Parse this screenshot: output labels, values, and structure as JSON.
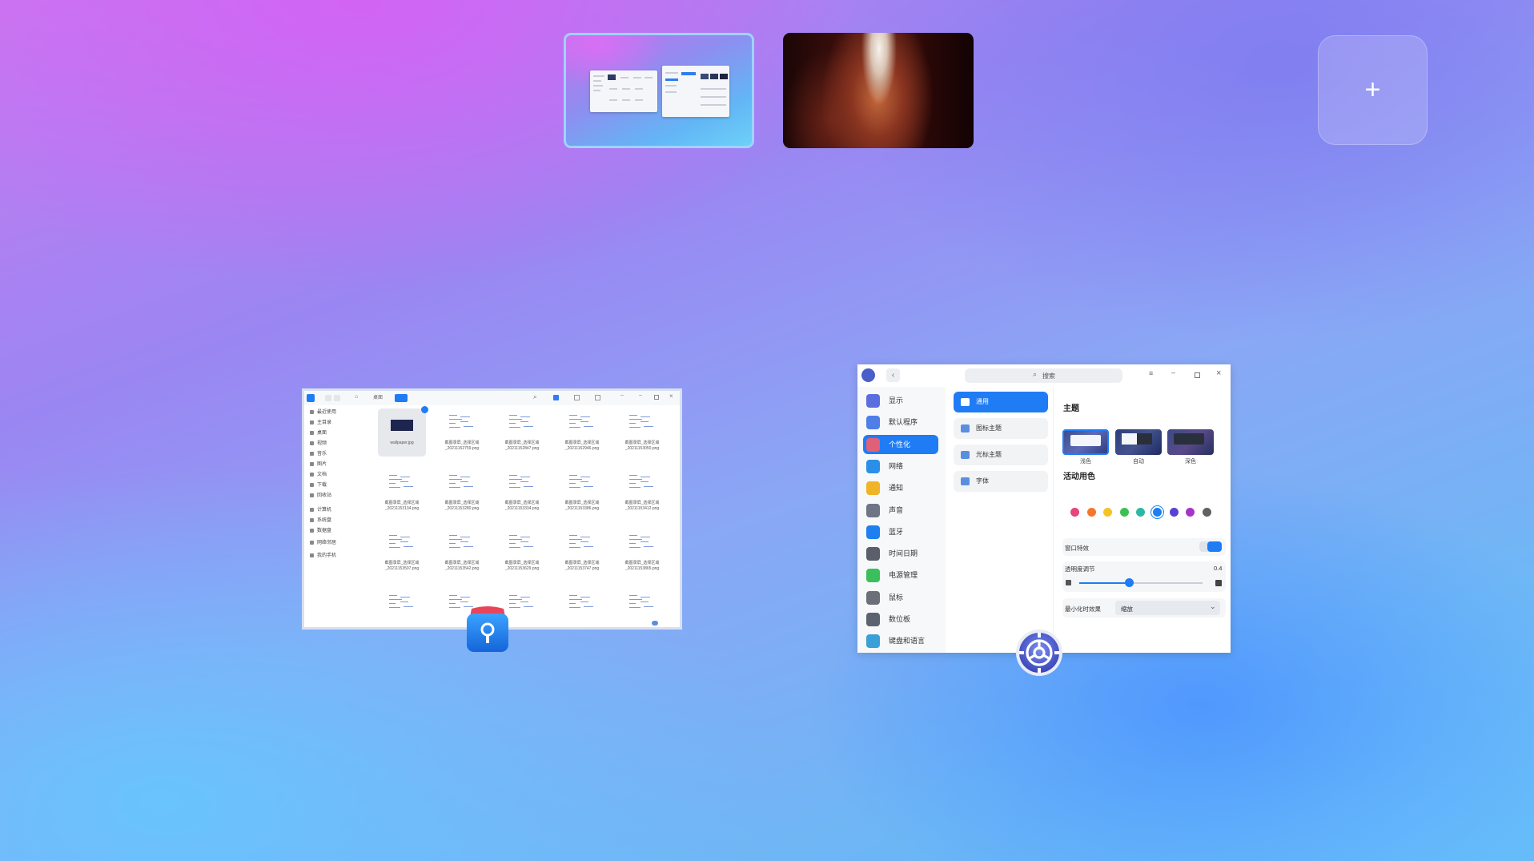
{
  "workspaces": {
    "add_label": "+"
  },
  "file_manager": {
    "path_label": "桌面",
    "sidebar": [
      "最近使用",
      "主目录",
      "桌面",
      "视频",
      "音乐",
      "图片",
      "文档",
      "下载",
      "回收站",
      "计算机",
      "系统盘",
      "数据盘",
      "网络邻居",
      "我的手机"
    ],
    "files": [
      "wallpaper.jpg",
      "截图录屏_选择区域_20211152759.png",
      "截图录屏_选择区域_20211152847.png",
      "截图录屏_选择区域_20211152946.png",
      "截图录屏_选择区域_20211153050.png",
      "截图录屏_选择区域_20211153134.png",
      "截图录屏_选择区域_20211153280.png",
      "截图录屏_选择区域_20211153334.png",
      "截图录屏_选择区域_20211153386.png",
      "截图录屏_选择区域_20211153412.png",
      "截图录屏_选择区域_20211153507.png",
      "截图录屏_选择区域_20211153542.png",
      "截图录屏_选择区域_20211153629.png",
      "截图录屏_选择区域_20211153747.png",
      "截图录屏_选择区域_20211153865.png",
      "",
      "",
      "",
      "",
      ""
    ]
  },
  "settings": {
    "search_placeholder": "搜索",
    "nav": [
      {
        "label": "显示",
        "color": "#5b6ee0",
        "icon": "display-icon"
      },
      {
        "label": "默认程序",
        "color": "#4f7ee8",
        "icon": "default-apps-icon"
      },
      {
        "label": "个性化",
        "color": "#e0607a",
        "icon": "personalization-icon",
        "active": true
      },
      {
        "label": "网络",
        "color": "#2b8fe8",
        "icon": "network-icon"
      },
      {
        "label": "通知",
        "color": "#f0b429",
        "icon": "bell-icon"
      },
      {
        "label": "声音",
        "color": "#6e7685",
        "icon": "speaker-icon"
      },
      {
        "label": "蓝牙",
        "color": "#1e7ff0",
        "icon": "bluetooth-icon"
      },
      {
        "label": "时间日期",
        "color": "#5a5f6b",
        "icon": "clock-icon"
      },
      {
        "label": "电源管理",
        "color": "#3bbf5c",
        "icon": "power-icon"
      },
      {
        "label": "鼠标",
        "color": "#6b6f78",
        "icon": "mouse-icon"
      },
      {
        "label": "数位板",
        "color": "#5b6270",
        "icon": "tablet-icon"
      },
      {
        "label": "键盘和语言",
        "color": "#3aa0d8",
        "icon": "keyboard-icon"
      }
    ],
    "sub_nav": [
      {
        "label": "通用",
        "icon": "window-icon",
        "active": true
      },
      {
        "label": "图标主题",
        "icon": "snowflake-icon"
      },
      {
        "label": "光标主题",
        "icon": "cursor-icon"
      },
      {
        "label": "字体",
        "icon": "font-icon"
      }
    ],
    "theme_title": "主题",
    "themes": [
      "浅色",
      "自动",
      "深色"
    ],
    "accent_title": "活动用色",
    "accent_colors": [
      "#e5457a",
      "#f5762c",
      "#f4c326",
      "#3cc053",
      "#2db8a4",
      "#1d7ef0",
      "#5b3fd6",
      "#a634c8",
      "#616161"
    ],
    "selected_accent": 5,
    "window_effect_label": "窗口特效",
    "window_effect_on": true,
    "transparency_label": "透明度调节",
    "transparency_value": "0.4",
    "transparency_level": 0.4,
    "minimize_label": "最小化时效果",
    "minimize_value": "缩放"
  }
}
